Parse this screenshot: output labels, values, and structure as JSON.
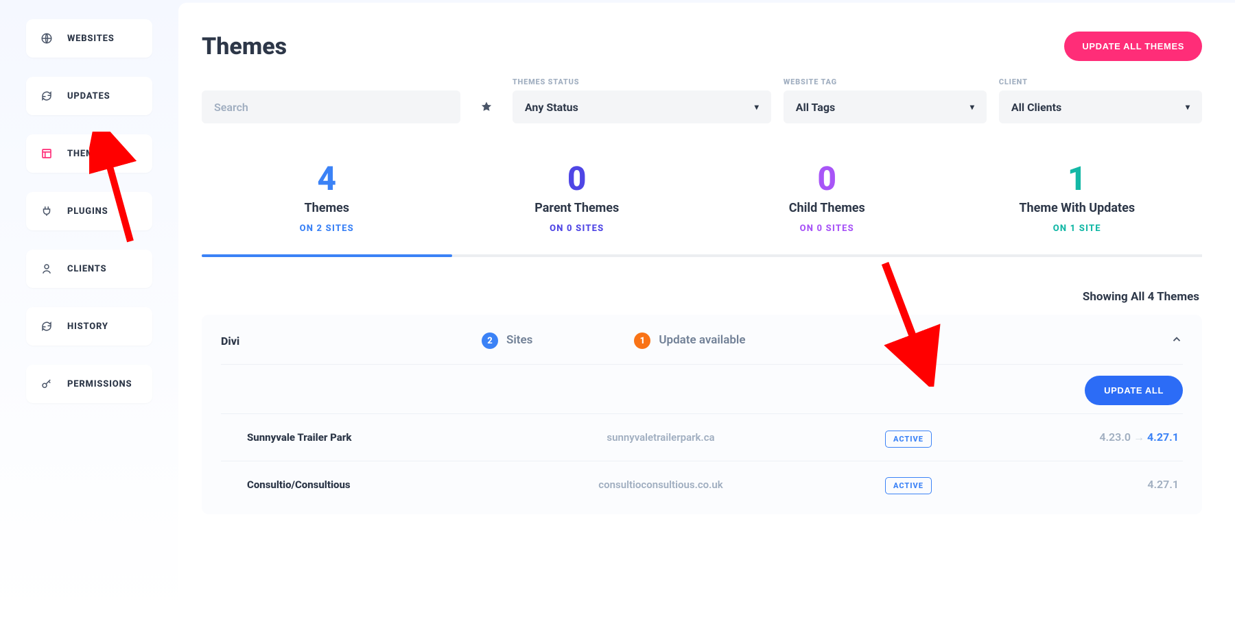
{
  "sidebar": {
    "items": [
      {
        "id": "websites",
        "label": "WEBSITES"
      },
      {
        "id": "updates",
        "label": "UPDATES"
      },
      {
        "id": "themes",
        "label": "THEMES"
      },
      {
        "id": "plugins",
        "label": "PLUGINS"
      },
      {
        "id": "clients",
        "label": "CLIENTS"
      },
      {
        "id": "history",
        "label": "HISTORY"
      },
      {
        "id": "permissions",
        "label": "PERMISSIONS"
      }
    ],
    "active_id": "themes"
  },
  "header": {
    "title": "Themes",
    "update_all_label": "UPDATE ALL THEMES"
  },
  "filters": {
    "search_placeholder": "Search",
    "status_label": "THEMES STATUS",
    "status_value": "Any Status",
    "tag_label": "WEBSITE TAG",
    "tag_value": "All Tags",
    "client_label": "CLIENT",
    "client_value": "All Clients"
  },
  "stats": [
    {
      "num": "4",
      "label": "Themes",
      "sub": "ON 2 SITES",
      "class": "stat-themes",
      "active": true
    },
    {
      "num": "0",
      "label": "Parent Themes",
      "sub": "ON 0 SITES",
      "class": "stat-parent"
    },
    {
      "num": "0",
      "label": "Child Themes",
      "sub": "ON 0 SITES",
      "class": "stat-child"
    },
    {
      "num": "1",
      "label": "Theme With Updates",
      "sub": "ON 1 SITE",
      "class": "stat-upd"
    }
  ],
  "showing_text": "Showing All 4 Themes",
  "panel": {
    "theme_name": "Divi",
    "sites_count": "2",
    "sites_label": "Sites",
    "updates_count": "1",
    "updates_label": "Update available",
    "update_all_label": "UPDATE ALL",
    "rows": [
      {
        "name": "Sunnyvale Trailer Park",
        "host": "sunnyvaletrailerpark.ca",
        "status": "ACTIVE",
        "old": "4.23.0",
        "new": "4.27.1",
        "has_update": true
      },
      {
        "name": "Consultio/Consultious",
        "host": "consultioconsultious.co.uk",
        "status": "ACTIVE",
        "old": "",
        "new": "4.27.1",
        "has_update": false
      }
    ]
  }
}
